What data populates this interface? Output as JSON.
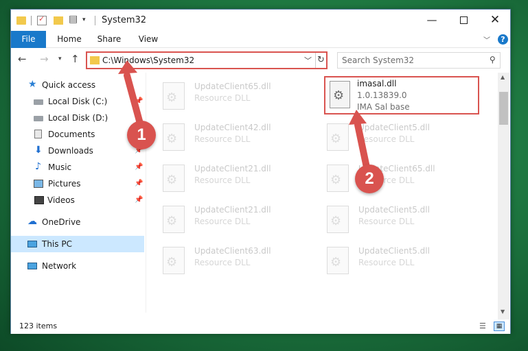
{
  "titlebar": {
    "title": "System32",
    "minimize": "—",
    "maximize": "☐",
    "close": "✕"
  },
  "ribbon": {
    "tabs": [
      "File",
      "Home",
      "Share",
      "View"
    ],
    "help": "?"
  },
  "navbar": {
    "address": "C:\\Windows\\System32",
    "search_placeholder": "Search System32"
  },
  "sidebar": {
    "items": [
      {
        "label": "Quick access",
        "icon": "star-icon"
      },
      {
        "label": "Local Disk (C:)",
        "icon": "drive-icon",
        "pinned": true
      },
      {
        "label": "Local Disk (D:)",
        "icon": "drive-icon"
      },
      {
        "label": "Documents",
        "icon": "documents-icon",
        "pinned": true
      },
      {
        "label": "Downloads",
        "icon": "download-icon",
        "pinned": true
      },
      {
        "label": "Music",
        "icon": "music-icon",
        "pinned": true
      },
      {
        "label": "Pictures",
        "icon": "pictures-icon",
        "pinned": true
      },
      {
        "label": "Videos",
        "icon": "videos-icon",
        "pinned": true
      },
      {
        "label": "OneDrive",
        "icon": "cloud-icon"
      },
      {
        "label": "This PC",
        "icon": "pc-icon",
        "selected": true
      },
      {
        "label": "Network",
        "icon": "network-icon"
      }
    ]
  },
  "files": {
    "highlighted": {
      "name": "imasal.dll",
      "version": "1.0.13839.0",
      "description": "IMA Sal base"
    },
    "background": [
      {
        "name": "UpdateClient65.dll",
        "type": "Resource DLL"
      },
      {
        "name": "UpdateClient42.dll",
        "type": "Resource DLL"
      },
      {
        "name": "UpdateClient5.dll",
        "type": "Resource DLL"
      },
      {
        "name": "UpdateClient21.dll",
        "type": "Resource DLL"
      },
      {
        "name": "UpdateClient65.dll",
        "type": "Resource DLL"
      },
      {
        "name": "UpdateClient21.dll",
        "type": "Resource DLL"
      },
      {
        "name": "UpdateClient5.dll",
        "type": "Resource DLL"
      },
      {
        "name": "UpdateClient63.dll",
        "type": "Resource DLL"
      },
      {
        "name": "UpdateClient5.dll",
        "type": "Resource DLL"
      }
    ]
  },
  "status": {
    "item_count": "123 items"
  },
  "annotations": {
    "step1": "1",
    "step2": "2",
    "color": "#d9534f"
  }
}
